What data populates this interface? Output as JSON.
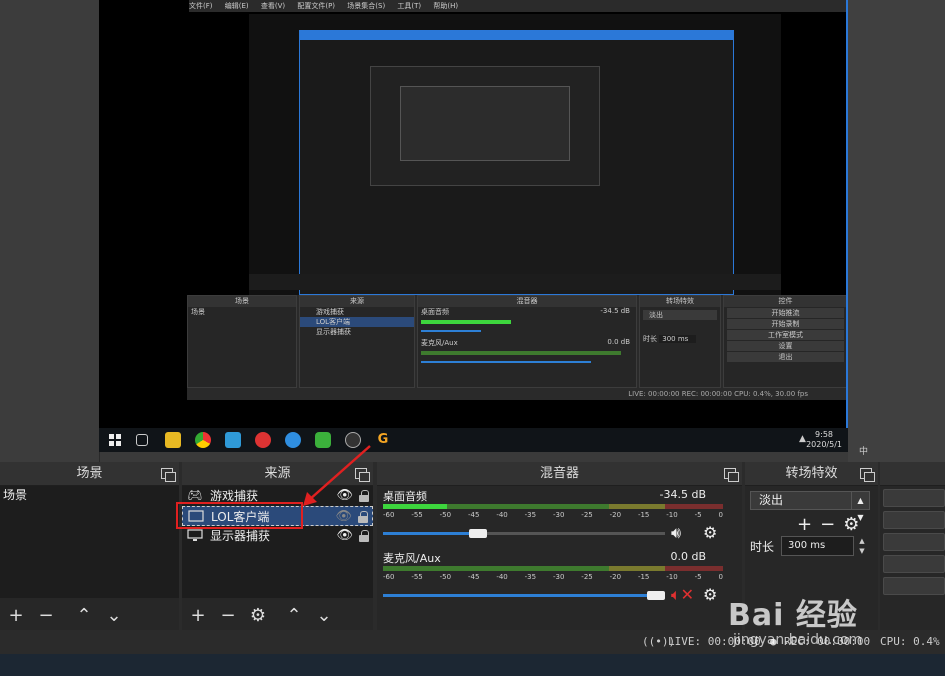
{
  "captured_screen": {
    "menu": [
      "文件(F)",
      "编辑(E)",
      "查看(V)",
      "配置文件(P)",
      "场景集合(S)",
      "工具(T)",
      "帮助(H)"
    ],
    "docks": {
      "scenes_title": "场景",
      "scenes_item": "场景",
      "sources_title": "来源",
      "sources_items": [
        "游戏捕获",
        "LOL客户端",
        "显示器捕获"
      ],
      "mixer_title": "混音器",
      "mixer_ch1": "桌面音频",
      "mixer_ch1_db": "-34.5 dB",
      "mixer_ch2": "麦克风/Aux",
      "mixer_ch2_db": "0.0 dB",
      "transitions_title": "转场特效",
      "transitions_value": "淡出",
      "duration_label": "时长",
      "duration_value": "300 ms",
      "controls_title": "控件",
      "controls_buttons": [
        "开始推流",
        "开始录制",
        "工作室模式",
        "设置",
        "退出"
      ]
    },
    "status": "LIVE: 00:00:00   REC: 00:00:00   CPU: 0.4%, 30.00 fps"
  },
  "taskbar": {
    "time": "9:58",
    "date": "2020/5/1",
    "ime": "中"
  },
  "scenes": {
    "title": "场景",
    "items": [
      "场景"
    ]
  },
  "sources": {
    "title": "来源",
    "items": [
      {
        "label": "游戏捕获",
        "icon": "gamepad-icon",
        "visible": true
      },
      {
        "label": "LOL客户端",
        "icon": "window-icon",
        "visible": false,
        "selected": true
      },
      {
        "label": "显示器捕获",
        "icon": "monitor-icon",
        "visible": true
      }
    ]
  },
  "mixer": {
    "title": "混音器",
    "channels": [
      {
        "name": "桌面音频",
        "db": "-34.5 dB",
        "muted": false,
        "volume": 0.3
      },
      {
        "name": "麦克风/Aux",
        "db": "0.0 dB",
        "muted": true,
        "volume": 1.0
      }
    ],
    "scale": [
      "-60",
      "-55",
      "-50",
      "-45",
      "-40",
      "-35",
      "-30",
      "-25",
      "-20",
      "-15",
      "-10",
      "-5",
      "0"
    ]
  },
  "transitions": {
    "title": "转场特效",
    "selected": "淡出",
    "duration_label": "时长",
    "duration_value": "300 ms"
  },
  "controls": {
    "title": "控件"
  },
  "statusbar": {
    "live": "LIVE: 00:00:00",
    "rec": "REC: 00:00:00",
    "cpu": "CPU: 0.4%"
  },
  "watermark": {
    "brand": "Bai 经验",
    "url": "jingyan.baidu.com"
  },
  "colors": {
    "accent": "#2d7fd5",
    "selection": "#2b4a7a",
    "highlight_box": "#e02020"
  }
}
